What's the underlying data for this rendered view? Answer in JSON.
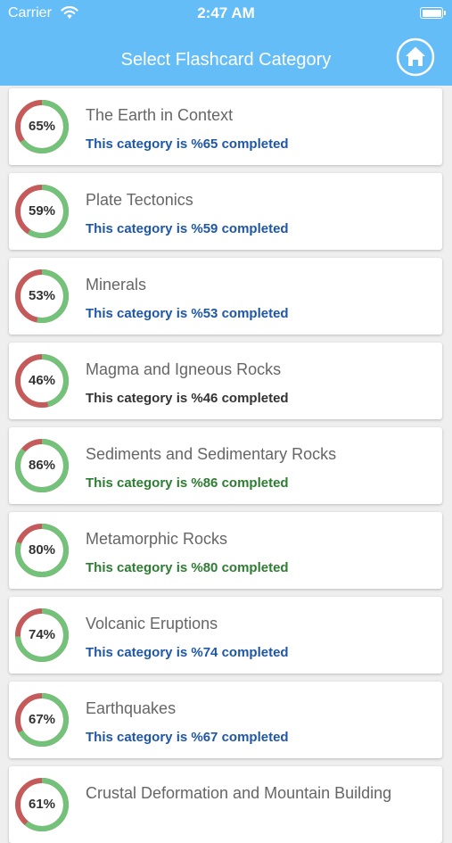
{
  "status_bar": {
    "carrier": "Carrier",
    "time": "2:47 AM"
  },
  "nav": {
    "title": "Select Flashcard Category"
  },
  "colors": {
    "header": "#64bdf7",
    "ring_complete": "#72c27a",
    "ring_incomplete": "#c55a5a",
    "status_blue": "#1f57a6",
    "status_dark": "#333333",
    "status_green": "#2e7d32"
  },
  "categories": [
    {
      "title": "The Earth in Context",
      "percent_label": "65%",
      "progress": 0.65,
      "status": "This category is %65 completed",
      "status_color": "#1f57a6"
    },
    {
      "title": "Plate Tectonics",
      "percent_label": "59%",
      "progress": 0.59,
      "status": "This category is %59 completed",
      "status_color": "#1f57a6"
    },
    {
      "title": "Minerals",
      "percent_label": "53%",
      "progress": 0.53,
      "status": "This category is %53 completed",
      "status_color": "#1f57a6"
    },
    {
      "title": "Magma and Igneous Rocks",
      "percent_label": "46%",
      "progress": 0.46,
      "status": "This category is %46 completed",
      "status_color": "#333333"
    },
    {
      "title": "Sediments and Sedimentary Rocks",
      "percent_label": "86%",
      "progress": 0.86,
      "status": "This category is %86 completed",
      "status_color": "#2e7d32"
    },
    {
      "title": "Metamorphic Rocks",
      "percent_label": "80%",
      "progress": 0.8,
      "status": "This category is %80 completed",
      "status_color": "#2e7d32"
    },
    {
      "title": "Volcanic Eruptions",
      "percent_label": "74%",
      "progress": 0.74,
      "status": "This category is %74 completed",
      "status_color": "#1f57a6"
    },
    {
      "title": "Earthquakes",
      "percent_label": "67%",
      "progress": 0.67,
      "status": "This category is %67 completed",
      "status_color": "#1f57a6"
    },
    {
      "title": "Crustal Deformation and Mountain Building",
      "percent_label": "61%",
      "progress": 0.61,
      "status": "",
      "status_color": "#1f57a6"
    }
  ]
}
